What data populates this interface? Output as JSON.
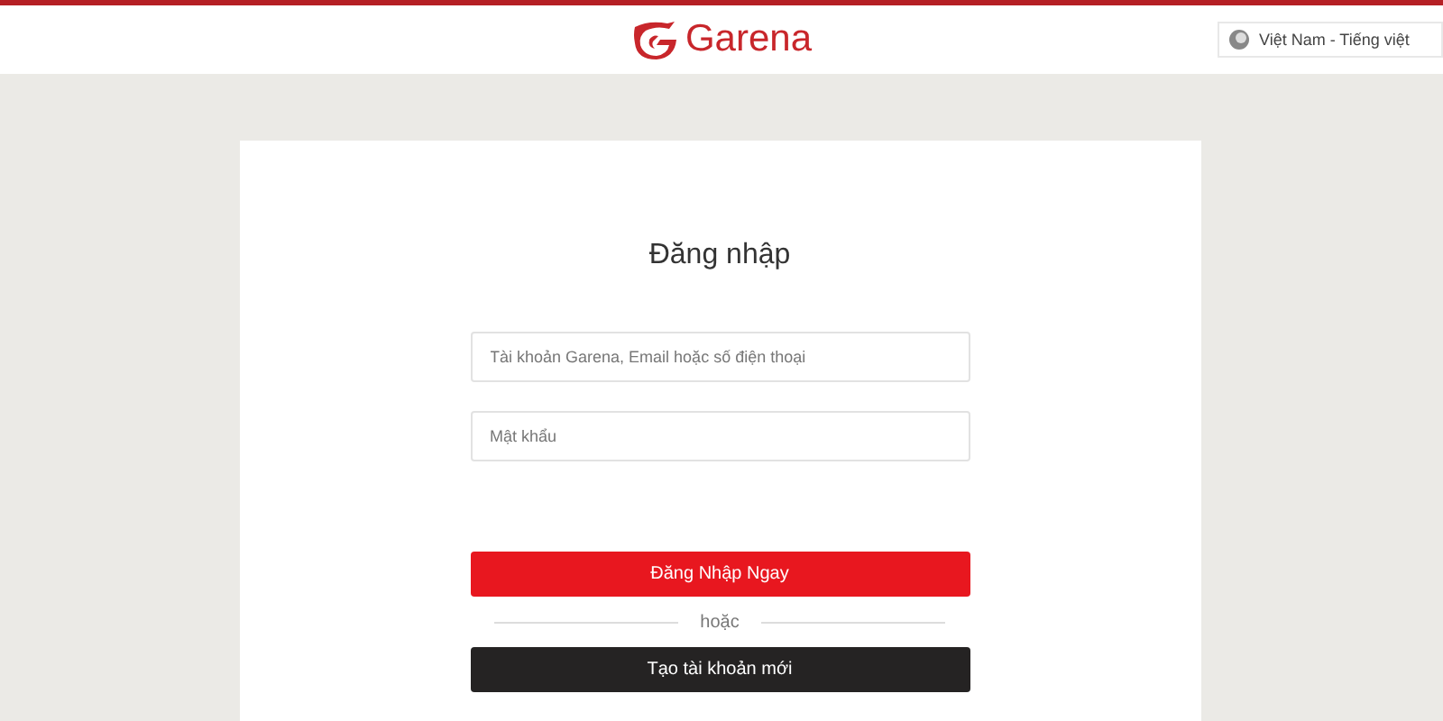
{
  "header": {
    "brand": "Garena",
    "language": "Việt Nam - Tiếng việt"
  },
  "login": {
    "title": "Đăng nhập",
    "account": {
      "placeholder": "Tài khoản Garena, Email hoặc số điện thoại"
    },
    "password": {
      "placeholder": "Mật khẩu"
    },
    "submit": "Đăng Nhập Ngay",
    "divider": "hoặc",
    "register": "Tạo tài khoản mới"
  }
}
